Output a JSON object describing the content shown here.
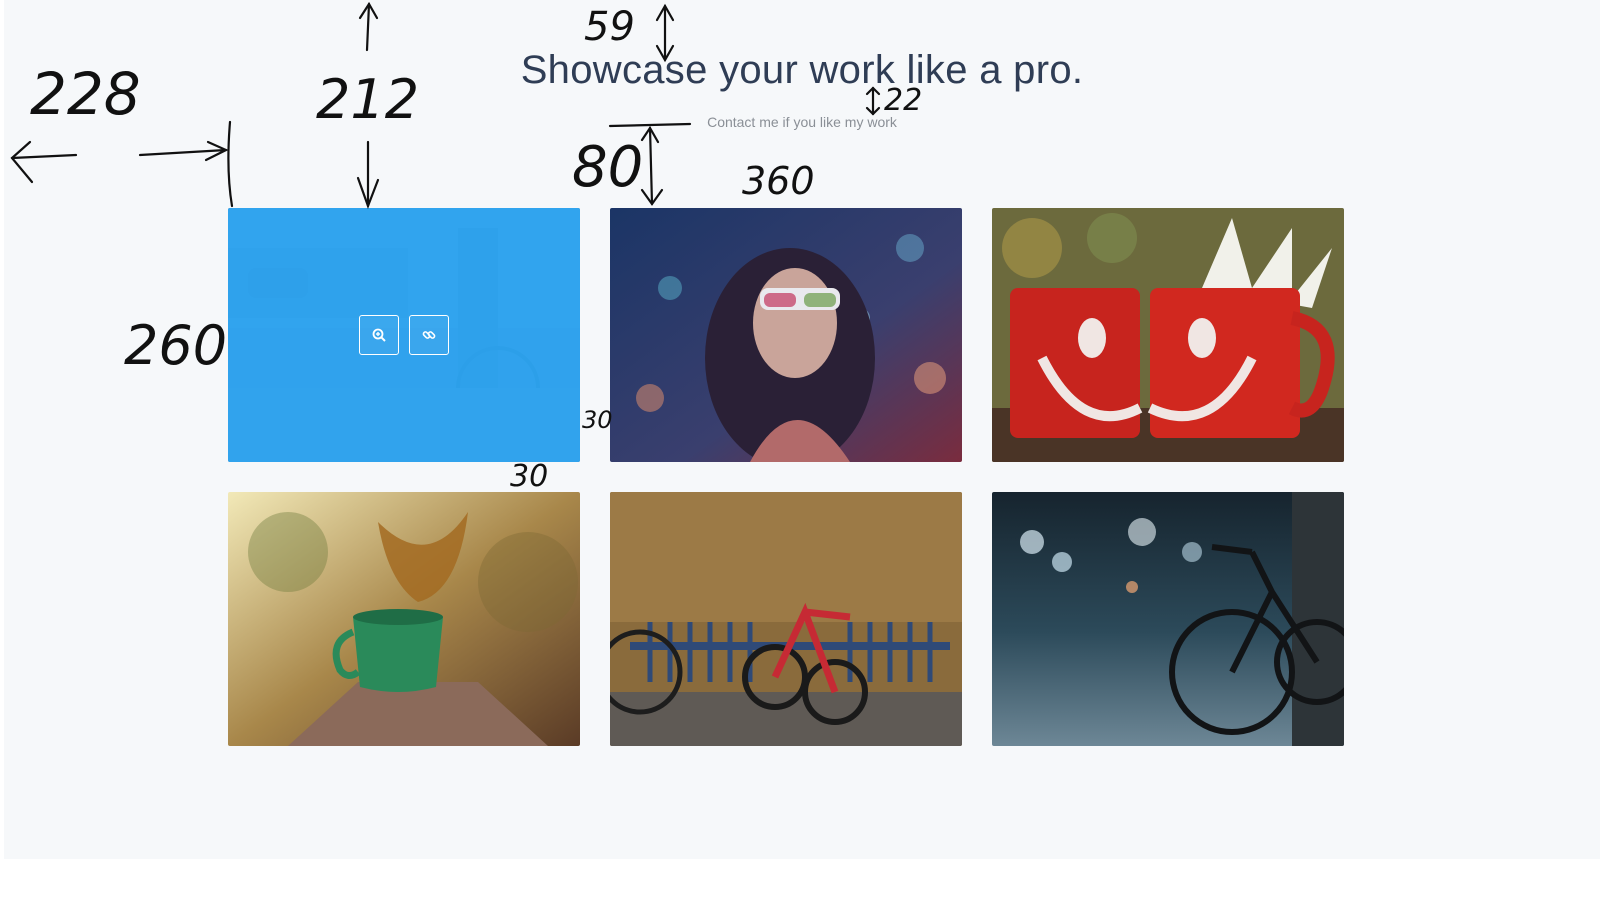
{
  "header": {
    "title": "Showcase your work like a pro.",
    "subtitle": "Contact me if you like my work"
  },
  "portfolio": {
    "items": [
      {
        "name": "street bicycle",
        "hover_actions": [
          "zoom-icon",
          "link-icon"
        ]
      },
      {
        "name": "woman with sunglasses"
      },
      {
        "name": "red smiley mugs"
      },
      {
        "name": "green cup splash"
      },
      {
        "name": "red bicycle"
      },
      {
        "name": "bicycle on street"
      }
    ]
  },
  "annotations": {
    "left_margin": "228",
    "top_offset": "212",
    "title_top": "59",
    "title_gap": "22",
    "subtitle_gap": "80",
    "tile_width": "360",
    "tile_height": "260",
    "col_gap": "30",
    "row_gap": "30"
  },
  "colors": {
    "background": "#f6f8fa",
    "title": "#2f3d55",
    "overlay": "#29a3f1"
  }
}
